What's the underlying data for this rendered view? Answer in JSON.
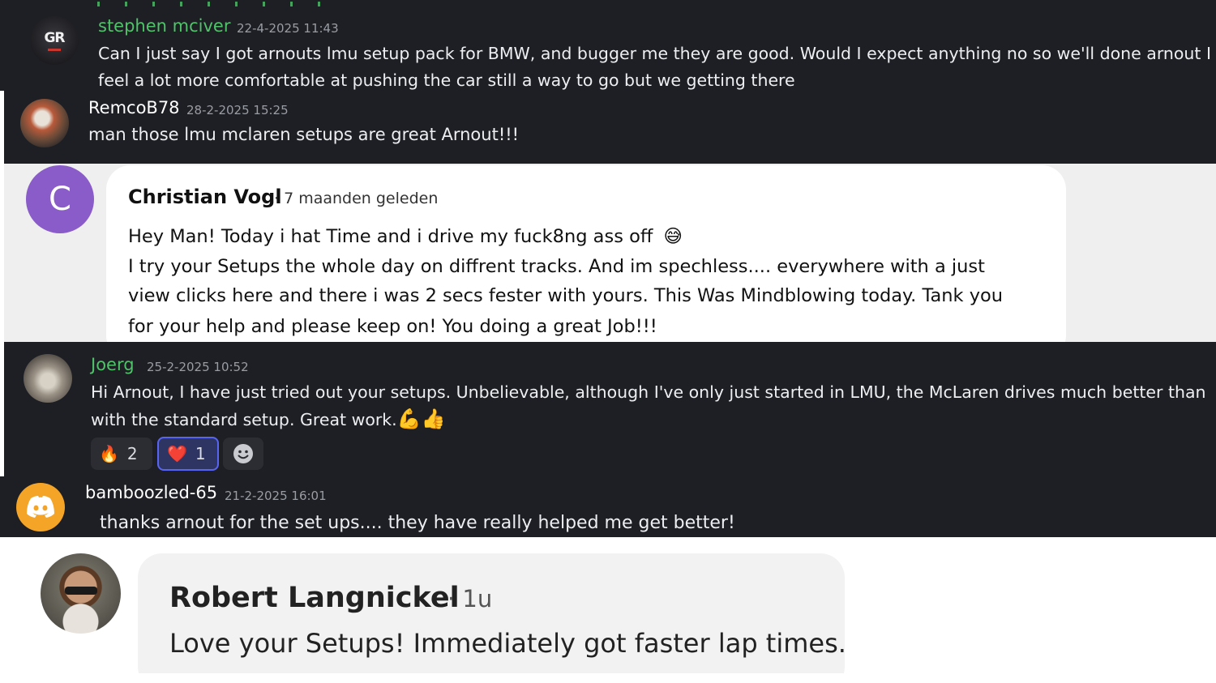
{
  "comments": {
    "stephen": {
      "username": "stephen mciver",
      "timestamp": "22-4-2025 11:43",
      "text_line1": "Can I just say I got arnouts lmu setup pack for BMW, and bugger me they are good. Would I expect anything no so we'll done arnout I",
      "text_line2": "feel a lot more comfortable at pushing the car still a way to go but we getting there",
      "avatar_text": "GR"
    },
    "remco": {
      "username": "RemcoB78",
      "timestamp": "28-2-2025 15:25",
      "text": "man those lmu mclaren setups are great Arnout!!!"
    },
    "christian": {
      "avatar_letter": "C",
      "username": "Christian Vogl",
      "time_ago": "· 7 maanden geleden",
      "text_line1": "Hey Man! Today i hat Time and i drive my fuck8ng ass off",
      "text_line2": "I try your Setups the whole day on diffrent tracks. And im spechless.... everywhere with a just",
      "text_line3": "view clicks here and there i was 2 secs fester with yours. This Was Mindblowing today. Tank you",
      "text_line4": "for your help and please keep on! You doing a great Job!!!",
      "emoji": "😅"
    },
    "joerg": {
      "username": "Joerg",
      "timestamp": "25-2-2025 10:52",
      "text_line1": "Hi Arnout, I have just tried out your setups. Unbelievable, although I've only just started in LMU, the McLaren drives much better than",
      "text_line2": "with the standard setup. Great work.",
      "emojis": "💪👍",
      "reactions": [
        {
          "emoji": "🔥",
          "count": "2"
        },
        {
          "emoji": "❤️",
          "count": "1"
        }
      ],
      "add_reaction_icon": "smiley-icon"
    },
    "bamboozled": {
      "username": "bamboozled-65",
      "timestamp": "21-2-2025 16:01",
      "text": "thanks arnout for the set ups.... they have really helped me get better!"
    },
    "robert": {
      "username": "Robert Langnickel",
      "time_ago": "· 1u",
      "text": "Love your Setups! Immediately got faster lap times."
    }
  },
  "colors": {
    "dark_bg": "#1e1f24",
    "green_username": "#4fc26a",
    "christian_avatar": "#8a5cc9",
    "discord_avatar": "#f4a427",
    "light_bg": "#efefef"
  }
}
